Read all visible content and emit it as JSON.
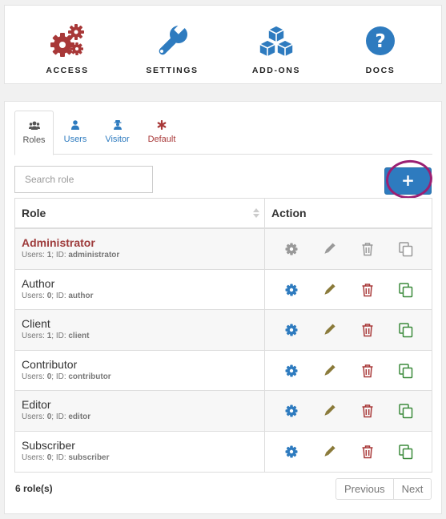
{
  "top_nav": [
    {
      "label": "ACCESS",
      "icon": "gears-icon",
      "color": "#a83838"
    },
    {
      "label": "SETTINGS",
      "icon": "wrench-icon",
      "color": "#2e7bbf"
    },
    {
      "label": "ADD-ONS",
      "icon": "cubes-icon",
      "color": "#2e7bbf"
    },
    {
      "label": "DOCS",
      "icon": "question-circle-icon",
      "color": "#2e7bbf"
    }
  ],
  "tabs": [
    {
      "label": "Roles",
      "icon": "users-icon",
      "active": true
    },
    {
      "label": "Users",
      "icon": "user-icon",
      "active": false
    },
    {
      "label": "Visitor",
      "icon": "visitor-icon",
      "active": false
    },
    {
      "label": "Default",
      "icon": "asterisk-icon",
      "active": false
    }
  ],
  "search": {
    "placeholder": "Search role"
  },
  "add_button": {
    "label": "+"
  },
  "table": {
    "headers": {
      "role": "Role",
      "action": "Action"
    },
    "rows": [
      {
        "name": "Administrator",
        "users_label": "Users:",
        "users": "1",
        "id_label": "ID:",
        "id": "administrator",
        "highlight": true
      },
      {
        "name": "Author",
        "users_label": "Users:",
        "users": "0",
        "id_label": "ID:",
        "id": "author",
        "highlight": false
      },
      {
        "name": "Client",
        "users_label": "Users:",
        "users": "1",
        "id_label": "ID:",
        "id": "client",
        "highlight": false
      },
      {
        "name": "Contributor",
        "users_label": "Users:",
        "users": "0",
        "id_label": "ID:",
        "id": "contributor",
        "highlight": false
      },
      {
        "name": "Editor",
        "users_label": "Users:",
        "users": "0",
        "id_label": "ID:",
        "id": "editor",
        "highlight": false
      },
      {
        "name": "Subscriber",
        "users_label": "Users:",
        "users": "0",
        "id_label": "ID:",
        "id": "subscriber",
        "highlight": false
      }
    ],
    "actions": [
      "gear-icon",
      "pencil-icon",
      "trash-icon",
      "copy-icon"
    ]
  },
  "footer": {
    "count": "6 role(s)",
    "previous": "Previous",
    "next": "Next"
  },
  "colors": {
    "accent": "#2e7bbf",
    "danger": "#a83838",
    "success": "#3a8a3a",
    "edit": "#8a7a3a",
    "muted": "#999999",
    "highlight_circle": "#9a1f72"
  }
}
